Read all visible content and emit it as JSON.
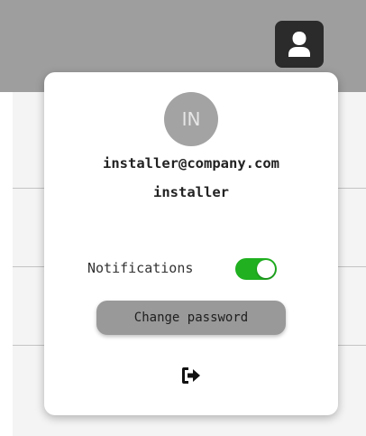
{
  "header": {
    "account_icon": "user-icon",
    "background_color": "#9e9e9e"
  },
  "account_menu": {
    "avatar_initials": "IN",
    "email": "installer@company.com",
    "username": "installer",
    "notifications": {
      "label": "Notifications",
      "enabled": true,
      "toggle_color": "#20b020"
    },
    "change_password_label": "Change password",
    "logout_icon": "logout-icon"
  }
}
